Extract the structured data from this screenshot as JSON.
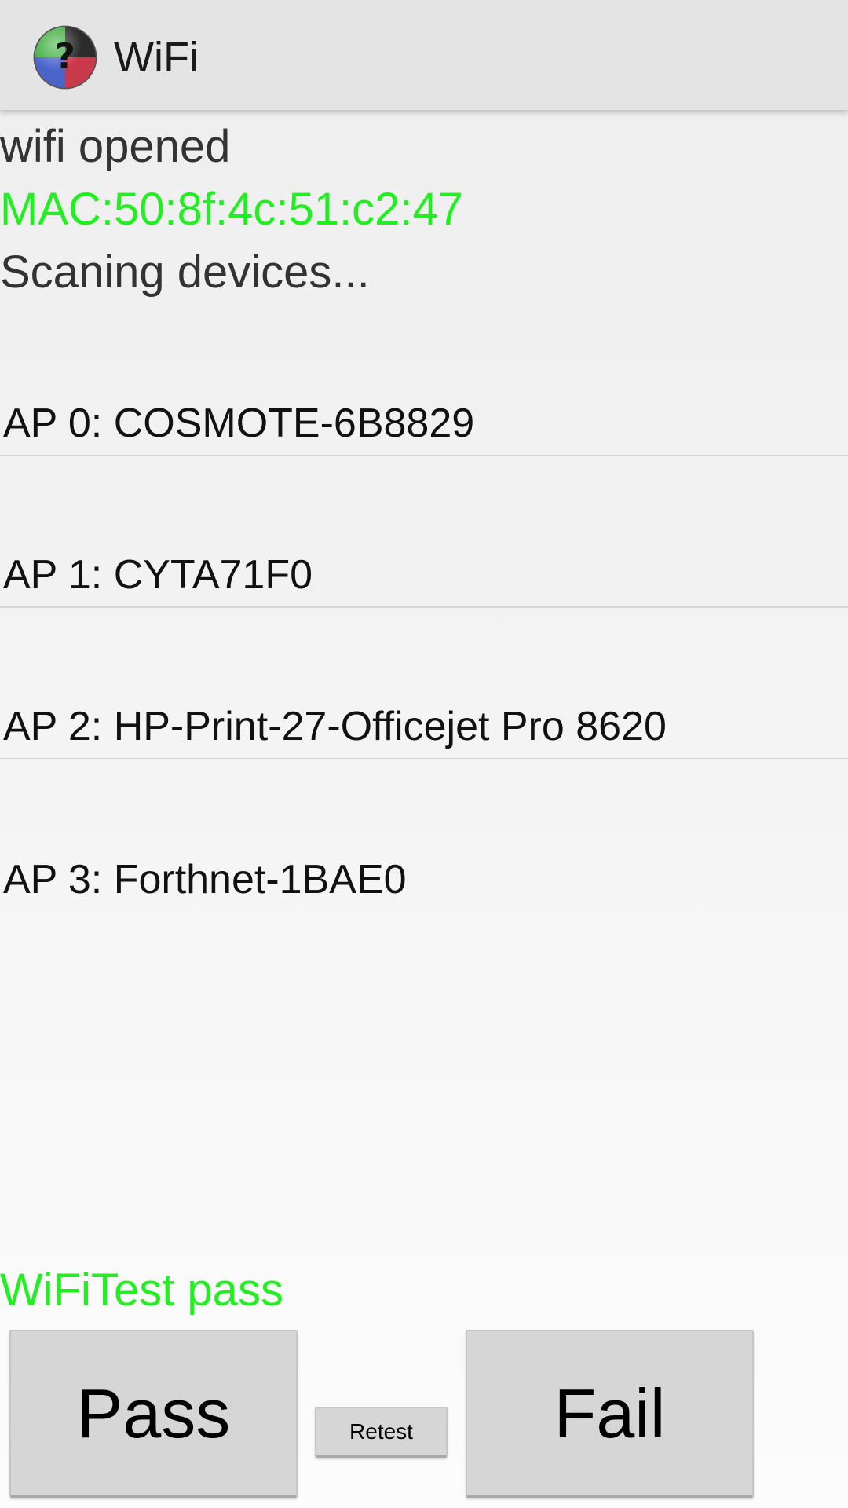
{
  "app": {
    "title": "WiFi",
    "icon": "help-question-icon"
  },
  "status": {
    "wifi_state": "wifi opened",
    "mac_address": "MAC:50:8f:4c:51:c2:47",
    "scan_state": "Scaning devices..."
  },
  "access_points": [
    {
      "label": "AP 0: COSMOTE-6B8829"
    },
    {
      "label": "AP 1: CYTA71F0"
    },
    {
      "label": "AP 2: HP-Print-27-Officejet Pro 8620"
    },
    {
      "label": "AP 3: Forthnet-1BAE0"
    }
  ],
  "result": {
    "text": "WiFiTest pass"
  },
  "buttons": {
    "pass_label": "Pass",
    "retest_label": "Retest",
    "fail_label": "Fail"
  },
  "colors": {
    "success_green": "#22ee22",
    "action_bar": "#e4e4e4",
    "button_gray": "#d6d6d6"
  }
}
